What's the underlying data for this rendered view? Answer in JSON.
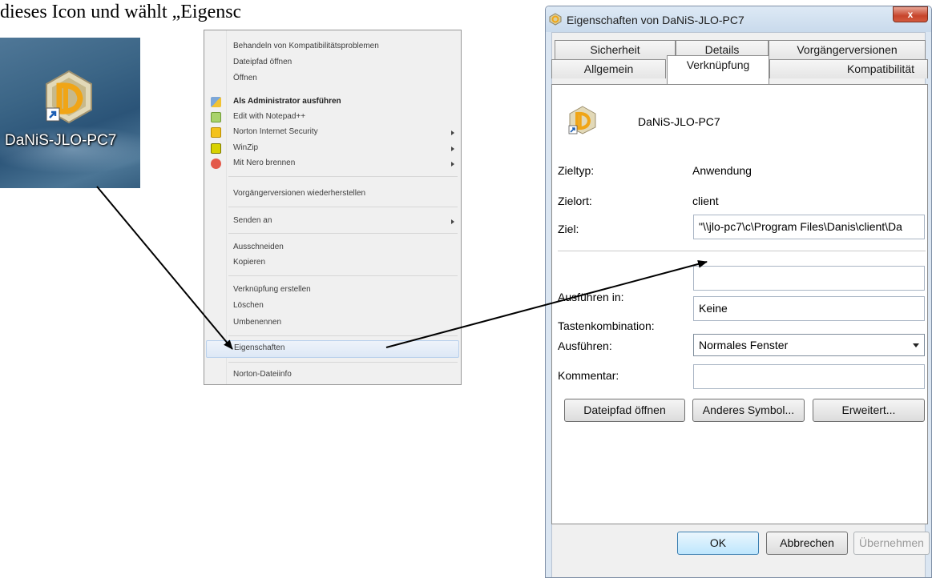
{
  "doc_fragment": "dieses Icon und wählt „Eigenschaften“.",
  "desktop": {
    "icon_label": "DaNiS-JLO-PC7"
  },
  "context_menu": {
    "items": [
      {
        "label": "Behandeln von Kompatibilitätsproblemen",
        "icon": "",
        "bold": false,
        "submenu": false
      },
      {
        "label": "Dateipfad öffnen",
        "icon": "",
        "bold": false,
        "submenu": false
      },
      {
        "label": "Öffnen",
        "icon": "",
        "bold": false,
        "submenu": false
      },
      {
        "label": "Als Administrator ausführen",
        "icon": "shield-icon",
        "bold": true,
        "submenu": false
      },
      {
        "label": "Edit with Notepad++",
        "icon": "notepad-icon",
        "bold": false,
        "submenu": false
      },
      {
        "label": "Norton Internet Security",
        "icon": "norton-icon",
        "bold": false,
        "submenu": true
      },
      {
        "label": "WinZip",
        "icon": "winzip-icon",
        "bold": false,
        "submenu": true
      },
      {
        "label": "Mit Nero brennen",
        "icon": "nero-icon",
        "bold": false,
        "submenu": true
      },
      {
        "label": "Vorgängerversionen wiederherstellen",
        "icon": "",
        "bold": false,
        "submenu": false
      },
      {
        "label": "Senden an",
        "icon": "",
        "bold": false,
        "submenu": true
      },
      {
        "label": "Ausschneiden",
        "icon": "",
        "bold": false,
        "submenu": false
      },
      {
        "label": "Kopieren",
        "icon": "",
        "bold": false,
        "submenu": false
      },
      {
        "label": "Verknüpfung erstellen",
        "icon": "",
        "bold": false,
        "submenu": false
      },
      {
        "label": "Löschen",
        "icon": "",
        "bold": false,
        "submenu": false
      },
      {
        "label": "Umbenennen",
        "icon": "",
        "bold": false,
        "submenu": false
      },
      {
        "label": "Eigenschaften",
        "icon": "",
        "bold": false,
        "submenu": false,
        "highlighted": true
      },
      {
        "label": "Norton-Dateiinfo",
        "icon": "",
        "bold": false,
        "submenu": false
      }
    ]
  },
  "dialog": {
    "title": "Eigenschaften von DaNiS-JLO-PC7",
    "close_glyph": "x",
    "tabs_row1": [
      "Sicherheit",
      "Details",
      "Vorgängerversionen"
    ],
    "tabs_row2": [
      "Allgemein",
      "Verknüpfung",
      "Kompatibilität"
    ],
    "active_tab": "Verknüpfung",
    "shortcut_name": "DaNiS-JLO-PC7",
    "fields": {
      "zieltyp_label": "Zieltyp:",
      "zieltyp_value": "Anwendung",
      "zielort_label": "Zielort:",
      "zielort_value": "client",
      "ziel_label": "Ziel:",
      "ziel_value": "\"\\\\jlo-pc7\\c\\Program Files\\Danis\\client\\Da",
      "ausfuehren_in_label": "Ausführen in:",
      "ausfuehren_in_value": "",
      "tasten_label": "Tastenkombination:",
      "tasten_value": "Keine",
      "ausfuehren_label": "Ausführen:",
      "ausfuehren_value": "Normales Fenster",
      "kommentar_label": "Kommentar:",
      "kommentar_value": ""
    },
    "buttons": {
      "open_path": "Dateipfad öffnen",
      "change_icon": "Anderes Symbol...",
      "advanced": "Erweitert...",
      "ok": "OK",
      "cancel": "Abbrechen",
      "apply": "Übernehmen"
    }
  },
  "colors": {
    "accent": "#3c7fb1",
    "close_button": "#c7452c",
    "highlight": "#dde8f6"
  }
}
